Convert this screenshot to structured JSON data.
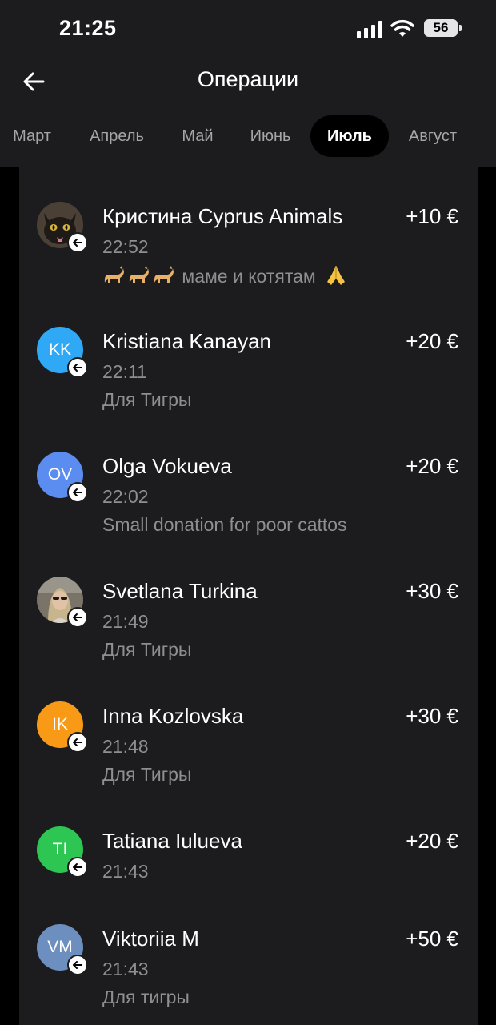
{
  "status": {
    "time": "21:25",
    "battery": "56"
  },
  "header": {
    "title": "Операции"
  },
  "tabs": [
    {
      "label": "Март"
    },
    {
      "label": "Апрель"
    },
    {
      "label": "Май"
    },
    {
      "label": "Июнь"
    },
    {
      "label": "Июль",
      "active": true
    },
    {
      "label": "Август"
    }
  ],
  "operations": [
    {
      "name": "Кристина Cyprus Animals",
      "amount": "+10 €",
      "time": "22:52",
      "comment": "маме и котятам",
      "avatar": "photo-cat"
    },
    {
      "name": "Kristiana Kanayan",
      "amount": "+20 €",
      "time": "22:11",
      "comment": "Для Тигры",
      "initials": "KK",
      "color": "#2fa9f5"
    },
    {
      "name": "Olga Vokueva",
      "amount": "+20 €",
      "time": "22:02",
      "comment": "Small donation for poor cattos",
      "initials": "OV",
      "color": "#5b8cf0"
    },
    {
      "name": "Svetlana Turkina",
      "amount": "+30 €",
      "time": "21:49",
      "comment": "Для Тигры",
      "avatar": "photo-person"
    },
    {
      "name": "Inna Kozlovska",
      "amount": "+30 €",
      "time": "21:48",
      "comment": "Для Тигры",
      "initials": "IK",
      "color": "#f99a17"
    },
    {
      "name": "Tatiana Iulueva",
      "amount": "+20 €",
      "time": "21:43",
      "comment": "",
      "initials": "TI",
      "color": "#2dc653"
    },
    {
      "name": "Viktoriia M",
      "amount": "+50 €",
      "time": "21:43",
      "comment": "Для тигры",
      "initials": "VM",
      "color": "#6c8fbf"
    }
  ]
}
